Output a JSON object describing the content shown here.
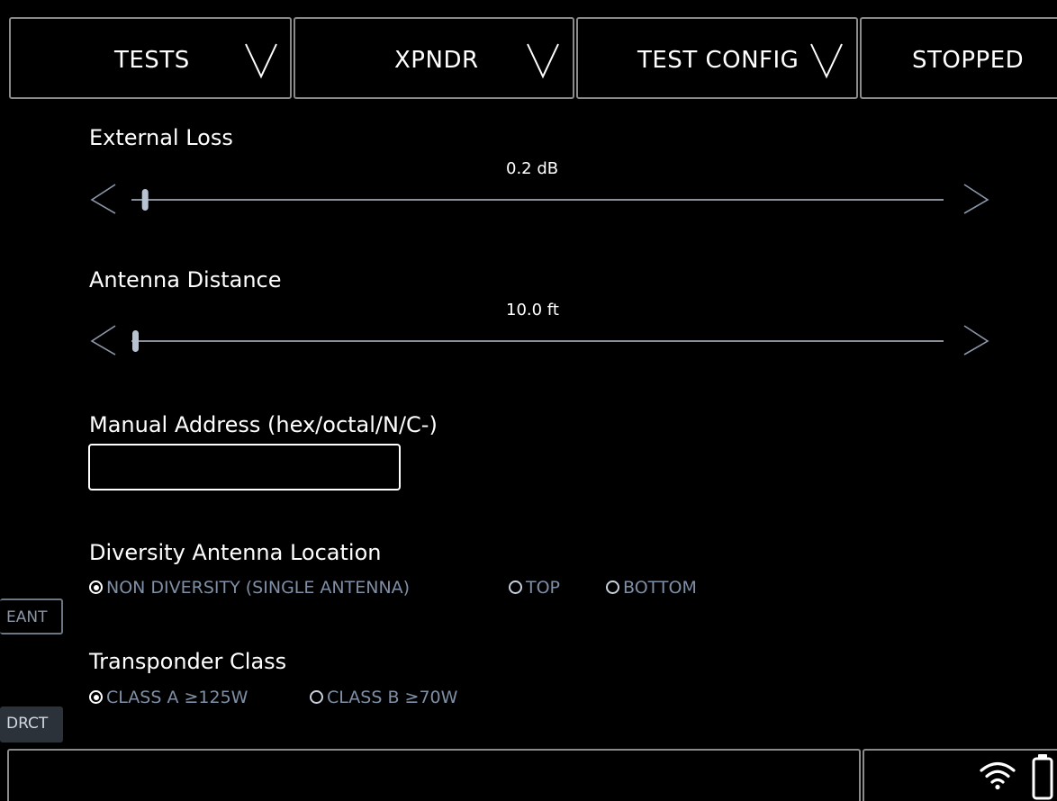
{
  "top_bar": {
    "tests_label": "TESTS",
    "xpndr_label": "XPNDR",
    "test_config_label": "TEST CONFIG",
    "status_label": "STOPPED"
  },
  "external_loss": {
    "label": "External Loss",
    "value_text": "0.2 dB",
    "level_fraction": 0.012
  },
  "antenna_distance": {
    "label": "Antenna Distance",
    "value_text": "10.0 ft",
    "level_fraction": 0.0
  },
  "manual_address": {
    "label": "Manual Address (hex/octal/N/C-)",
    "value": "",
    "placeholder": ""
  },
  "diversity": {
    "label": "Diversity Antenna Location",
    "options": [
      {
        "label": "NON DIVERSITY (SINGLE ANTENNA)",
        "selected": true
      },
      {
        "label": "TOP",
        "selected": false
      },
      {
        "label": "BOTTOM",
        "selected": false
      }
    ]
  },
  "transponder_class": {
    "label": "Transponder Class",
    "options": [
      {
        "label": "CLASS A ≥125W",
        "selected": true
      },
      {
        "label": "CLASS B ≥70W",
        "selected": false
      }
    ]
  },
  "side_buttons": {
    "eant_label": "EANT",
    "drct_label": "DRCT"
  },
  "icons": {
    "dropdown": "chevron-down-icon",
    "wifi": "wifi-icon",
    "battery": "battery-icon"
  },
  "colors": {
    "background": "#000000",
    "text": "#ffffff",
    "radio_text": "#7f8fa5",
    "border": "#8a8a8a"
  }
}
